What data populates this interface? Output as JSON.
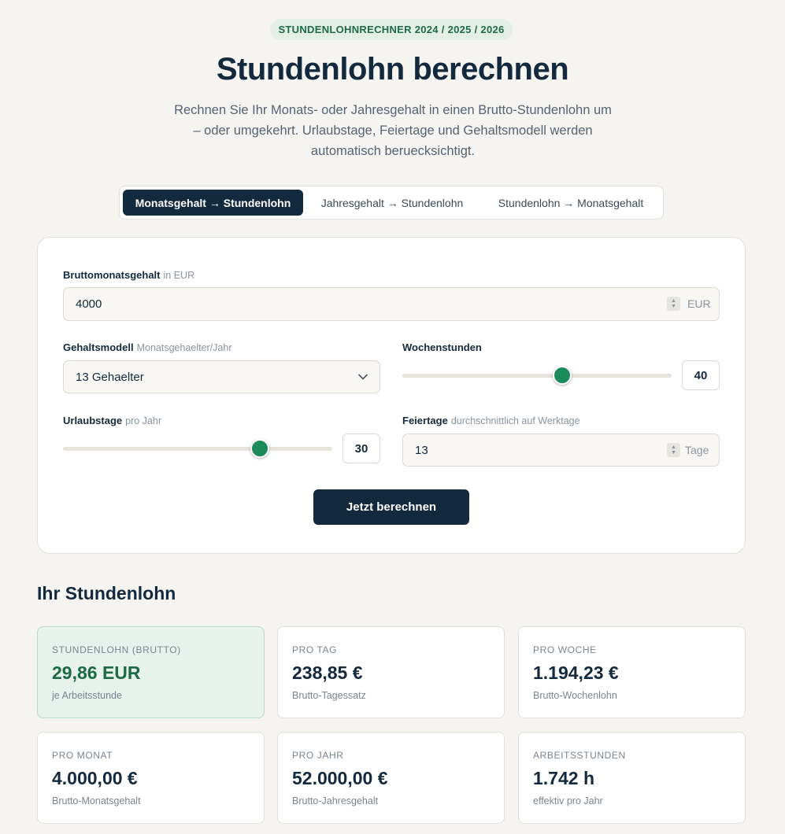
{
  "header": {
    "badge": "STUNDENLOHNRECHNER 2024 / 2025 / 2026",
    "title": "Stundenlohn berechnen",
    "subtitle": "Rechnen Sie Ihr Monats- oder Jahresgehalt in einen Brutto-Stundenlohn um – oder umgekehrt. Urlaubstage, Feiertage und Gehaltsmodell werden automatisch beruecksichtigt."
  },
  "tabs": [
    {
      "label": "Monatsgehalt → Stundenlohn",
      "active": true
    },
    {
      "label": "Jahresgehalt → Stundenlohn",
      "active": false
    },
    {
      "label": "Stundenlohn → Monatsgehalt",
      "active": false
    }
  ],
  "form": {
    "salary": {
      "label": "Bruttomonatsgehalt",
      "hint": "in EUR",
      "value": "4000",
      "unit": "EUR"
    },
    "model": {
      "label": "Gehaltsmodell",
      "hint": "Monatsgehaelter/Jahr",
      "value": "13 Gehaelter"
    },
    "hours": {
      "label": "Wochenstunden",
      "value": "40",
      "slider_fraction": 0.6
    },
    "vacation": {
      "label": "Urlaubstage",
      "hint": "pro Jahr",
      "value": "30",
      "slider_fraction": 0.73
    },
    "holidays": {
      "label": "Feiertage",
      "hint": "durchschnittlich auf Werktage",
      "value": "13",
      "unit": "Tage"
    },
    "submit_label": "Jetzt berechnen"
  },
  "results": {
    "title": "Ihr Stundenlohn",
    "cards": [
      {
        "key": "STUNDENLOHN (BRUTTO)",
        "value": "29,86 EUR",
        "sub": "je Arbeitsstunde",
        "highlight": true
      },
      {
        "key": "PRO TAG",
        "value": "238,85 €",
        "sub": "Brutto-Tagessatz"
      },
      {
        "key": "PRO WOCHE",
        "value": "1.194,23 €",
        "sub": "Brutto-Wochenlohn"
      },
      {
        "key": "PRO MONAT",
        "value": "4.000,00 €",
        "sub": "Brutto-Monatsgehalt"
      },
      {
        "key": "PRO JAHR",
        "value": "52.000,00 €",
        "sub": "Brutto-Jahresgehalt"
      },
      {
        "key": "ARBEITSSTUNDEN",
        "value": "1.742 h",
        "sub": "effektiv pro Jahr"
      }
    ]
  },
  "colors": {
    "accent": "#1c8a5a",
    "primary": "#13293d",
    "badge_bg": "#e4efe7"
  },
  "icons": [
    "chevron-down-icon",
    "spinner-arrows-icon"
  ]
}
